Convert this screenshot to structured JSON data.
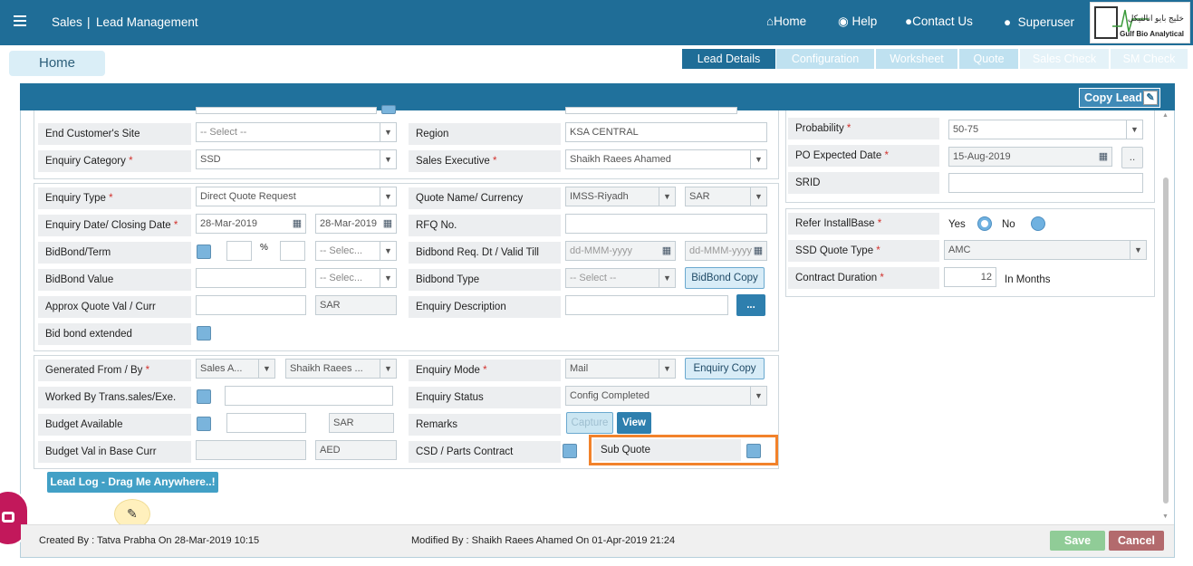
{
  "header": {
    "module": "Sales",
    "separator": "|",
    "page": "Lead Management",
    "nav": [
      {
        "label": "Home"
      },
      {
        "label": "Help"
      },
      {
        "label": "Contact Us"
      },
      {
        "label": "Superuser"
      }
    ],
    "logo_arabic": "خليج بايو انالتيكل",
    "logo_english": "Gulf Bio Analytical"
  },
  "tabs": [
    {
      "label": "Lead Details"
    },
    {
      "label": "Configuration"
    },
    {
      "label": "Worksheet"
    },
    {
      "label": "Quote"
    },
    {
      "label": "Sales Check"
    },
    {
      "label": "SM Check"
    }
  ],
  "home_label": "Home",
  "copy_lead_label": "Copy Lead",
  "s1": {
    "end_customer_site": "End Customer's Site",
    "end_customer_site_value": "-- Select --",
    "region": "Region",
    "region_value": "KSA CENTRAL",
    "enquiry_category": "Enquiry Category",
    "enquiry_category_value": "SSD",
    "sales_executive": "Sales Executive",
    "sales_executive_value": "Shaikh Raees Ahamed"
  },
  "s2": {
    "enquiry_type": "Enquiry Type",
    "enquiry_type_value": "Direct Quote Request",
    "quote_name": "Quote Name/ Currency",
    "quote_name_value": "IMSS-Riyadh",
    "currency_value": "SAR",
    "enquiry_date": "Enquiry Date/ Closing Date",
    "enquiry_date_value": "28-Mar-2019",
    "closing_date_value": "28-Mar-2019",
    "rfq": "RFQ No.",
    "bidbond_term": "BidBond/Term",
    "percent": "%",
    "select_short": "-- Selec...",
    "bidbond_req": "Bidbond Req. Dt / Valid Till",
    "date_placeholder": "dd-MMM-yyyy",
    "date_placeholder_short": "dd-MMM-yyyy",
    "bidbond_value": "BidBond Value",
    "bidbond_type": "Bidbond Type",
    "select_full": "-- Select --",
    "bidbond_copy": "BidBond Copy",
    "approx_quote": "Approx Quote Val / Curr",
    "approx_currency": "SAR",
    "enquiry_description": "Enquiry Description",
    "ellipsis_btn": "...",
    "bid_bond_extended": "Bid bond extended"
  },
  "s3": {
    "generated_from": "Generated From / By",
    "generated_from_value": "Sales A...",
    "generated_by_value": "Shaikh Raees ...",
    "enquiry_mode": "Enquiry Mode",
    "enquiry_mode_value": "Mail",
    "enquiry_copy": "Enquiry Copy",
    "worked_by": "Worked By Trans.sales/Exe.",
    "enquiry_status": "Enquiry Status",
    "enquiry_status_value": "Config Completed",
    "budget_available": "Budget Available",
    "budget_currency": "SAR",
    "remarks": "Remarks",
    "capture": "Capture",
    "view": "View",
    "budget_base": "Budget Val in Base Curr",
    "base_currency": "AED",
    "csd_parts": "CSD / Parts Contract",
    "sub_quote": "Sub Quote"
  },
  "right1": {
    "probability": "Probability",
    "probability_value": "50-75",
    "po_expected": "PO Expected Date",
    "po_expected_value": "15-Aug-2019",
    "po_btn": "..",
    "srid": "SRID"
  },
  "right2": {
    "refer_installbase": "Refer InstallBase",
    "yes": "Yes",
    "no": "No",
    "ssd_quote_type": "SSD Quote Type",
    "ssd_quote_type_value": "AMC",
    "contract_duration": "Contract Duration",
    "contract_duration_value": "12",
    "in_months": "In Months"
  },
  "lead_log": "Lead Log - Drag Me Anywhere..!",
  "footer": {
    "created": "Created By : Tatva Prabha On 28-Mar-2019 10:15",
    "modified": "Modified By : Shaikh Raees Ahamed On 01-Apr-2019 21:24",
    "save": "Save",
    "cancel": "Cancel"
  },
  "colors": {
    "header": "#1f6d97",
    "active_tab": "#1f6d97",
    "highlight": "#f2822b",
    "save": "#90cc97",
    "cancel": "#b36a6d"
  }
}
